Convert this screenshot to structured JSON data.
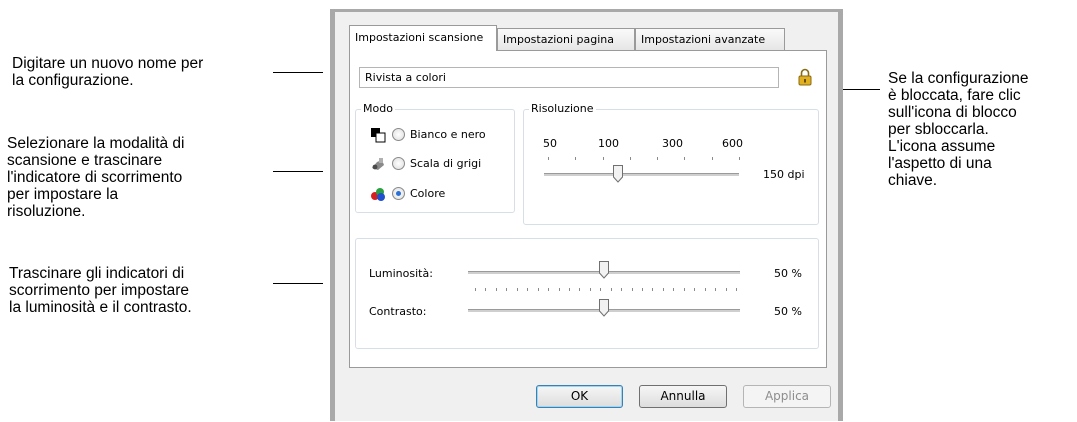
{
  "callouts": {
    "name": "Digitare un nuovo nome per\nla configurazione.",
    "mode": "Selezionare la modalità di\nscansione e trascinare\nl'indicatore di scorrimento\nper impostare la\nrisoluzione.",
    "brightness": "Trascinare gli indicatori di\nscorrimento per impostare\nla luminosità e il contrasto.",
    "lock": "Se la configurazione\nè bloccata, fare clic\nsull'icona di blocco\nper sbloccarla.\nL'icona assume\nl'aspetto di una\nchiave."
  },
  "tabs": [
    "Impostazioni scansione",
    "Impostazioni pagina",
    "Impostazioni avanzate"
  ],
  "name_field": {
    "value": "Rivista a colori"
  },
  "mode": {
    "label": "Modo",
    "options": [
      "Bianco e nero",
      "Scala di grigi",
      "Colore"
    ],
    "selected": "Colore"
  },
  "resolution": {
    "label": "Risoluzione",
    "ticks": [
      "50",
      "100",
      "300",
      "600"
    ],
    "value": "150 dpi",
    "slider_fraction": 0.38
  },
  "brightness": {
    "label": "Luminosità:",
    "value": "50 %",
    "slider_fraction": 0.5
  },
  "contrast": {
    "label": "Contrasto:",
    "value": "50 %",
    "slider_fraction": 0.5
  },
  "buttons": {
    "ok": "OK",
    "cancel": "Annulla",
    "apply": "Applica"
  },
  "colors": {
    "radio_selected": "#2a6fd8",
    "lock": "#e0b020"
  }
}
